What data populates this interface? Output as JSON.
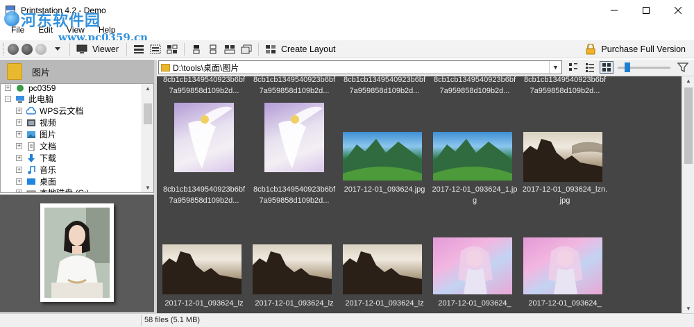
{
  "window": {
    "title": "Printstation 4.2 - Demo",
    "controls": [
      "minimize",
      "maximize",
      "close"
    ]
  },
  "watermark": {
    "line1": "河东软件园",
    "line2": "www.pc0359.cn"
  },
  "menu": [
    "File",
    "Edit",
    "View",
    "Help"
  ],
  "toolbar": {
    "viewer_label": "Viewer",
    "create_layout_label": "Create Layout",
    "purchase_label": "Purchase Full Version",
    "icons": [
      "back-icon",
      "up-icon",
      "forward-icon",
      "dropdown-icon",
      "monitor-icon",
      "layout-grid-icon",
      "layout-list-icon",
      "layout-tiles-icon",
      "single-icon",
      "double-icon",
      "stack-icon",
      "copy-icon",
      "layout-icon",
      "lock-icon",
      "gear-icon",
      "help-icon"
    ]
  },
  "left_panel": {
    "header_title": "图片",
    "tree": [
      {
        "label": "pc0359",
        "indent": 0,
        "icon": "pc-icon"
      },
      {
        "label": "此电脑",
        "indent": 0,
        "icon": "computer-icon"
      },
      {
        "label": "WPS云文档",
        "indent": 1,
        "icon": "cloud-icon"
      },
      {
        "label": "视频",
        "indent": 1,
        "icon": "video-icon"
      },
      {
        "label": "图片",
        "indent": 1,
        "icon": "picture-icon"
      },
      {
        "label": "文档",
        "indent": 1,
        "icon": "document-icon"
      },
      {
        "label": "下载",
        "indent": 1,
        "icon": "download-icon"
      },
      {
        "label": "音乐",
        "indent": 1,
        "icon": "music-icon"
      },
      {
        "label": "桌面",
        "indent": 1,
        "icon": "desktop-icon"
      },
      {
        "label": "本地磁盘 (C:)",
        "indent": 1,
        "icon": "drive-icon"
      }
    ]
  },
  "path_bar": {
    "path": "D:\\tools\\桌面\\图片"
  },
  "zoom": {
    "level": 0.15
  },
  "grid": {
    "top_row_captions": [
      "8cb1cb1349540923b6bf7a959858d109b2d...",
      "8cb1cb1349540923b6bf7a959858d109b2d...",
      "8cb1cb1349540923b6bf7a959858d109b2d...",
      "8cb1cb1349540923b6bf7a959858d109b2d...",
      "8cb1cb1349540923b6bf7a959858d109b2d..."
    ],
    "row2": [
      {
        "caption": "8cb1cb1349540923b6bf7a959858d109b2d...",
        "kind": "angel"
      },
      {
        "caption": "8cb1cb1349540923b6bf7a959858d109b2d...",
        "kind": "angel"
      },
      {
        "caption": "2017-12-01_093624.jpg",
        "kind": "landscape"
      },
      {
        "caption": "2017-12-01_093624_1.jpg",
        "kind": "landscape"
      },
      {
        "caption": "2017-12-01_093624_lzn.jpg",
        "kind": "ruins"
      }
    ],
    "row3": [
      {
        "caption": "2017-12-01_093624_lz",
        "kind": "ruins"
      },
      {
        "caption": "2017-12-01_093624_lz",
        "kind": "ruins"
      },
      {
        "caption": "2017-12-01_093624_lz",
        "kind": "ruins"
      },
      {
        "caption": "2017-12-01_093624_",
        "kind": "fairy"
      },
      {
        "caption": "2017-12-01_093624_",
        "kind": "fairy"
      }
    ]
  },
  "status": {
    "text": "58 files (5.1 MB)"
  }
}
